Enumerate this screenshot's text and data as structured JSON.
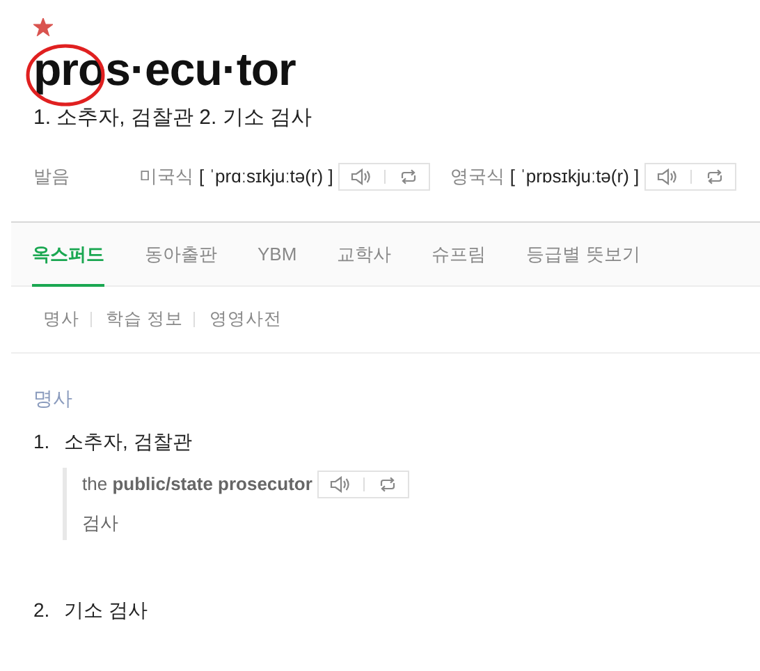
{
  "entry": {
    "starred": true,
    "headword": "pros·ecu·tor",
    "circled": true,
    "summary": "1. 소추자, 검찰관 2. 기소 검사"
  },
  "pronunciation": {
    "label": "발음",
    "variants": [
      {
        "label": "미국식",
        "ipa": "[ ˈprɑːsɪkjuːtə(r) ]"
      },
      {
        "label": "영국식",
        "ipa": "[ ˈprɒsɪkjuːtə(r) ]"
      }
    ]
  },
  "tabs": [
    {
      "label": "옥스퍼드",
      "selected": true
    },
    {
      "label": "동아출판",
      "selected": false
    },
    {
      "label": "YBM",
      "selected": false
    },
    {
      "label": "교학사",
      "selected": false
    },
    {
      "label": "슈프림",
      "selected": false
    },
    {
      "label": "등급별 뜻보기",
      "selected": false
    }
  ],
  "subnav": [
    "명사",
    "학습 정보",
    "영영사전"
  ],
  "section": {
    "part_of_speech": "명사",
    "senses": [
      {
        "number": "1.",
        "text": "소추자, 검찰관",
        "examples": [
          {
            "text": "the **public/state prosecutor**",
            "translation": "검사"
          }
        ]
      },
      {
        "number": "2.",
        "text": "기소 검사"
      }
    ]
  }
}
